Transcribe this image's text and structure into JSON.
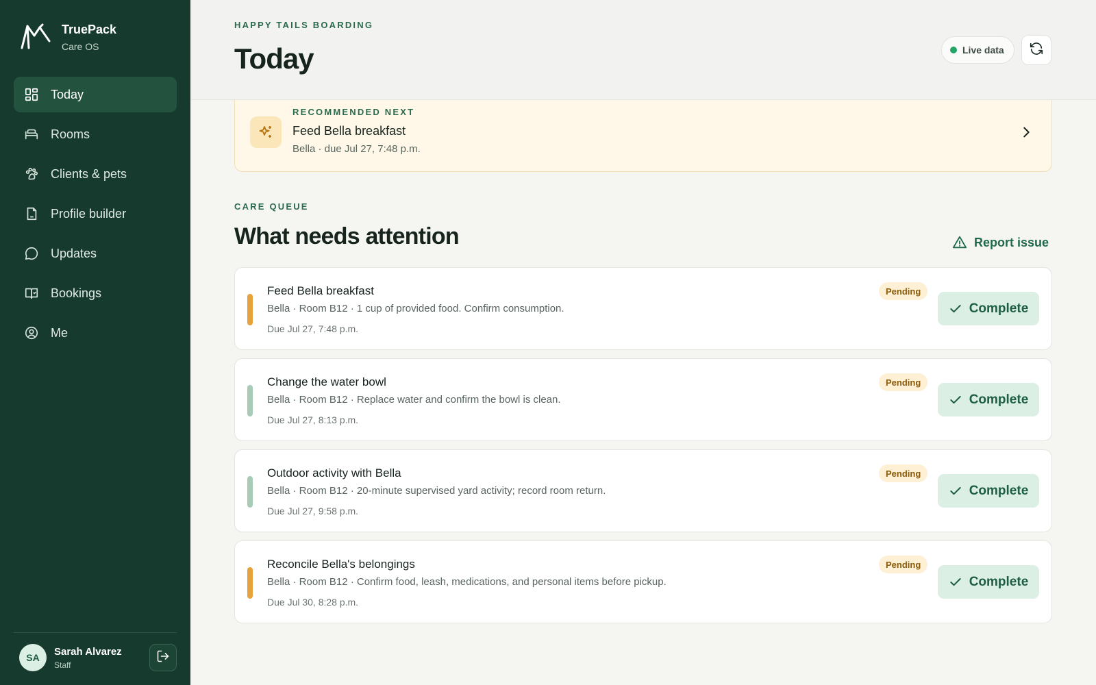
{
  "brand": {
    "name": "TruePack",
    "subtitle": "Care OS"
  },
  "nav": [
    {
      "label": "Today",
      "icon": "dashboard-icon",
      "active": true
    },
    {
      "label": "Rooms",
      "icon": "bed-icon",
      "active": false
    },
    {
      "label": "Clients & pets",
      "icon": "paw-icon",
      "active": false
    },
    {
      "label": "Profile builder",
      "icon": "document-icon",
      "active": false
    },
    {
      "label": "Updates",
      "icon": "chat-icon",
      "active": false
    },
    {
      "label": "Bookings",
      "icon": "book-check-icon",
      "active": false
    },
    {
      "label": "Me",
      "icon": "user-circle-icon",
      "active": false
    }
  ],
  "user": {
    "initials": "SA",
    "name": "Sarah Alvarez",
    "role": "Staff"
  },
  "header": {
    "eyebrow": "HAPPY TAILS BOARDING",
    "title": "Today",
    "live_label": "Live data"
  },
  "recommended": {
    "eyebrow": "RECOMMENDED NEXT",
    "title": "Feed Bella breakfast",
    "meta": "Bella · due Jul 27, 7:48 p.m."
  },
  "queue": {
    "eyebrow": "CARE QUEUE",
    "title": "What needs attention",
    "report_label": "Report issue",
    "complete_label": "Complete",
    "tasks": [
      {
        "title": "Feed Bella breakfast",
        "desc": "Bella · Room B12 · 1 cup of provided food. Confirm consumption.",
        "due": "Due Jul 27, 7:48 p.m.",
        "status": "Pending",
        "accent": "#e8a23a"
      },
      {
        "title": "Change the water bowl",
        "desc": "Bella · Room B12 · Replace water and confirm the bowl is clean.",
        "due": "Due Jul 27, 8:13 p.m.",
        "status": "Pending",
        "accent": "#a8cbb8"
      },
      {
        "title": "Outdoor activity with Bella",
        "desc": "Bella · Room B12 · 20-minute supervised yard activity; record room return.",
        "due": "Due Jul 27, 9:58 p.m.",
        "status": "Pending",
        "accent": "#a8cbb8"
      },
      {
        "title": "Reconcile Bella's belongings",
        "desc": "Bella · Room B12 · Confirm food, leash, medications, and personal items before pickup.",
        "due": "Due Jul 30, 8:28 p.m.",
        "status": "Pending",
        "accent": "#e8a23a"
      }
    ]
  },
  "colors": {
    "sidebar": "#163a2e",
    "accent_green": "#1f6a4b",
    "pending_bg": "#fdf0d4",
    "live_dot": "#23a565"
  }
}
